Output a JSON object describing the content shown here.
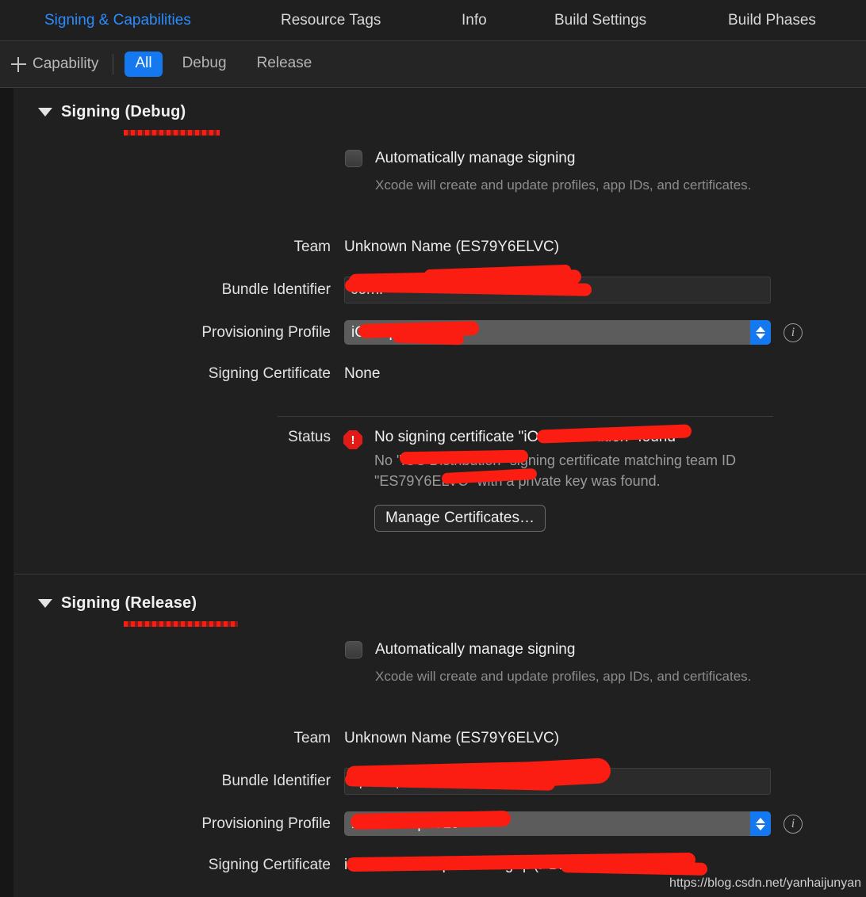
{
  "tabs": [
    {
      "label": "Signing & Capabilities",
      "active": true
    },
    {
      "label": "Resource Tags",
      "active": false
    },
    {
      "label": "Info",
      "active": false
    },
    {
      "label": "Build Settings",
      "active": false
    },
    {
      "label": "Build Phases",
      "active": false
    }
  ],
  "toolbar": {
    "capability_label": "Capability",
    "plus_icon": "plus-icon",
    "segments": [
      {
        "label": "All",
        "selected": true
      },
      {
        "label": "Debug",
        "selected": false
      },
      {
        "label": "Release",
        "selected": false
      }
    ]
  },
  "common": {
    "auto_manage_label": "Automatically manage signing",
    "auto_manage_desc": "Xcode will create and update profiles, app IDs, and certificates.",
    "team_label": "Team",
    "bundle_label": "Bundle Identifier",
    "profile_label": "Provisioning Profile",
    "certificate_label": "Signing Certificate",
    "status_label": "Status",
    "info_icon": "info-icon",
    "stepper_icon": "chevron-up-down-icon",
    "disclosure_icon": "disclosure-triangle-icon",
    "checkbox_icon": "checkbox-unchecked-icon"
  },
  "debug": {
    "section_title": "Signing (Debug)",
    "auto_manage_checked": false,
    "team_value": "Unknown Name (ES79Y6ELVC)",
    "bundle_value": "com.",
    "profile_value": "iOS                 op20",
    "certificate_value": "None",
    "status": {
      "error_icon": "error-octagon-icon",
      "error_glyph": "!",
      "title": "No signing certificate \"iOS Distribution\" found",
      "body": "No \"iOS Distribution\" signing certificate matching team ID \"ES79Y6ELVC\" with a private key was found.",
      "button_label": "Manage Certificates…"
    }
  },
  "release": {
    "section_title": "Signing (Release)",
    "auto_manage_checked": false,
    "team_value": "Unknown Name (ES79Y6ELVC)",
    "bundle_value": "                 npush.pe       ber",
    "profile_value": "iosDevelop2019",
    "certificate_value": "iPhone Developer: zhang qi (PBDEF            )"
  },
  "watermark": "https://blog.csdn.net/yanhaijunyan",
  "colors": {
    "accent_blue": "#1479f0",
    "tab_active": "#2b8cff",
    "error_red": "#e01b18",
    "redaction_red": "#fb1d12",
    "background": "#1e1e1e",
    "pane": "#202020"
  }
}
